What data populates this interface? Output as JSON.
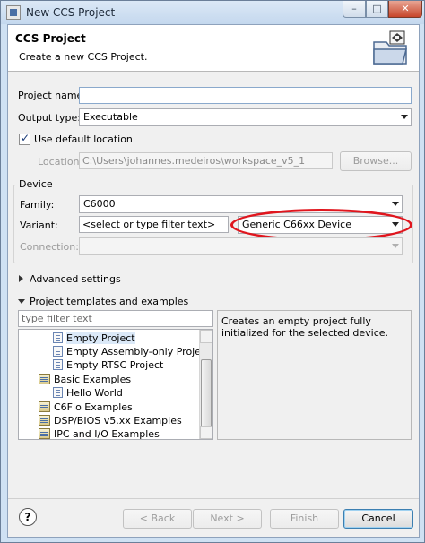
{
  "window": {
    "title": "New CCS Project",
    "controls": {
      "minimize": "–",
      "maximize": "□",
      "close": "✕"
    }
  },
  "header": {
    "title": "CCS Project",
    "subtitle": "Create a new CCS Project.",
    "banner_icon": "ccs-project-wizard-icon"
  },
  "form": {
    "project_name_label": "Project name:",
    "project_name_value": "",
    "output_type_label": "Output type:",
    "output_type_value": "Executable",
    "use_default_location_label": "Use default location",
    "use_default_location_checked": true,
    "location_label": "Location:",
    "location_value": "C:\\Users\\johannes.medeiros\\workspace_v5_1",
    "browse_label": "Browse..."
  },
  "device": {
    "group_title": "Device",
    "family_label": "Family:",
    "family_value": "C6000",
    "variant_label": "Variant:",
    "variant_filter_placeholder": "<select or type filter text>",
    "variant_value": "Generic C66xx Device",
    "connection_label": "Connection:",
    "connection_value": "",
    "highlight_color": "#e0161e"
  },
  "sections": {
    "advanced_settings": "Advanced settings",
    "templates": "Project templates and examples"
  },
  "templates": {
    "filter_placeholder": "type filter text",
    "items": [
      {
        "label": "Empty Project",
        "icon": "template-doc-icon",
        "selected": true
      },
      {
        "label": "Empty Assembly-only Project",
        "icon": "template-doc-icon"
      },
      {
        "label": "Empty RTSC Project",
        "icon": "template-doc-icon"
      },
      {
        "label": "Basic Examples",
        "icon": "folder-icon"
      },
      {
        "label": "Hello World",
        "icon": "template-doc-icon"
      },
      {
        "label": "C6Flo Examples",
        "icon": "folder-icon"
      },
      {
        "label": "DSP/BIOS v5.xx Examples",
        "icon": "folder-icon"
      },
      {
        "label": "IPC and I/O Examples",
        "icon": "folder-icon"
      }
    ],
    "description": "Creates an empty project fully initialized for the selected device."
  },
  "buttons": {
    "help": "?",
    "back": "< Back",
    "next": "Next >",
    "finish": "Finish",
    "cancel": "Cancel"
  }
}
